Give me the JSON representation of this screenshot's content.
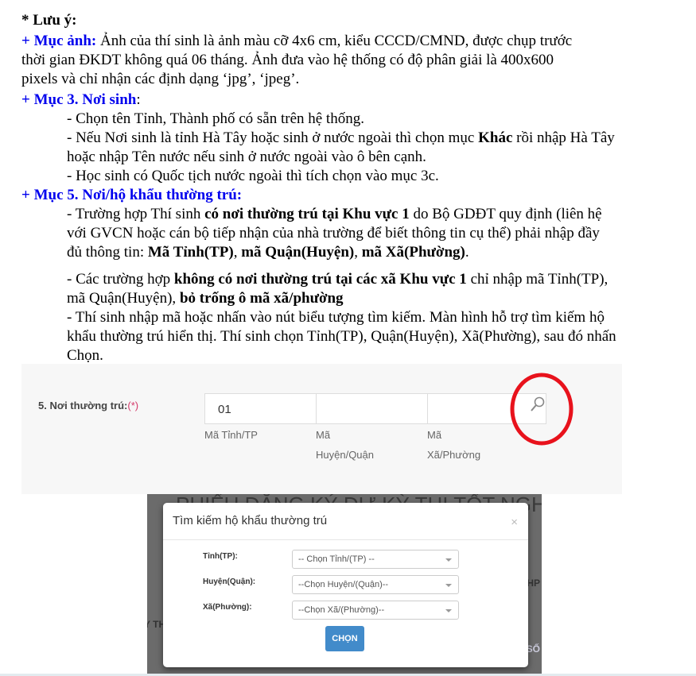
{
  "document": {
    "lines": [
      [
        {
          "t": "* Lưu ý:",
          "s": "b"
        }
      ],
      [
        {
          "t": "+ Mục ảnh:",
          "s": "bb"
        },
        {
          "t": " Ảnh của thí sinh là ảnh màu cỡ 4x6 cm, kiểu CCCD/CMND, được chụp trước",
          "s": "n"
        }
      ],
      [
        {
          "t": "thời gian ĐKDT không quá 06 tháng. Ảnh đưa vào hệ thống có độ phân giải là 400x600",
          "s": "n"
        }
      ],
      [
        {
          "t": "pixels và chỉ nhận các định dạng ‘jpg’, ‘jpeg’.",
          "s": "n"
        }
      ],
      [
        {
          "t": "+ Mục 3. Nơi sinh",
          "s": "bb"
        },
        {
          "t": ":",
          "s": "n"
        }
      ],
      [
        {
          "t": "- Chọn tên Tỉnh, Thành phố có sẵn trên hệ thống.",
          "s": "n"
        }
      ],
      [
        {
          "t": "- Nếu Nơi sinh là tỉnh Hà Tây hoặc sinh ở nước ngoài thì chọn mục ",
          "s": "n"
        },
        {
          "t": "Khác",
          "s": "b"
        },
        {
          "t": " rồi nhập Hà Tây",
          "s": "n"
        }
      ],
      [
        {
          "t": "hoặc nhập Tên nước nếu sinh ở nước ngoài vào ô bên cạnh.",
          "s": "n"
        }
      ],
      [
        {
          "t": "- Học sinh có Quốc tịch nước ngoài thì tích chọn vào mục 3c.",
          "s": "n"
        }
      ],
      [
        {
          "t": "+ Mục 5. Nơi/hộ khẩu thường trú:",
          "s": "bb"
        }
      ],
      [
        {
          "t": "- Trường hợp Thí sinh ",
          "s": "n"
        },
        {
          "t": "có nơi thường trú tại Khu vực 1",
          "s": "b"
        },
        {
          "t": " do Bộ GDĐT quy định (liên hệ",
          "s": "n"
        }
      ],
      [
        {
          "t": "với GVCN hoặc cán bộ tiếp nhận của nhà trường để biết thông tin cụ thể) phải nhập đầy",
          "s": "n"
        }
      ],
      [
        {
          "t": "đủ thông tin: ",
          "s": "n"
        },
        {
          "t": "Mã Tỉnh(TP)",
          "s": "b"
        },
        {
          "t": ", ",
          "s": "n"
        },
        {
          "t": "mã Quận(Huyện)",
          "s": "b"
        },
        {
          "t": ", ",
          "s": "n"
        },
        {
          "t": "mã Xã(Phường)",
          "s": "b"
        },
        {
          "t": ".",
          "s": "n"
        }
      ],
      [
        {
          "t": "- Các trường hợp ",
          "s": "n"
        },
        {
          "t": "không có nơi thường trú tại các xã Khu vực 1",
          "s": "b"
        },
        {
          "t": " chỉ nhập mã Tỉnh(TP),",
          "s": "n"
        }
      ],
      [
        {
          "t": "mã Quận(Huyện), ",
          "s": "n"
        },
        {
          "t": "bỏ trống ô mã xã/phường",
          "s": "b"
        }
      ],
      [
        {
          "t": "- Thí sinh nhập mã hoặc nhấn vào nút biểu tượng tìm kiếm. Màn hình hỗ trợ tìm kiếm hộ",
          "s": "n"
        }
      ],
      [
        {
          "t": "khẩu thường trú hiển thị. Thí sinh chọn Tỉnh(TP), Quận(Huyện), Xã(Phường), sau đó nhấn",
          "s": "n"
        }
      ],
      [
        {
          "t": "Chọn.",
          "s": "n"
        }
      ]
    ]
  },
  "form_screenshot": {
    "label": "5. Nơi thường trú:",
    "required_mark": "(*)",
    "province_code": "01",
    "district_code": "",
    "ward_code": "",
    "province_caption": "Mã Tỉnh/TP",
    "district_caption_1": "Mã",
    "district_caption_2": "Huyện/Quận",
    "ward_caption_1": "Mã",
    "ward_caption_2": "Xã/Phường",
    "search_icon": "magnifier-icon",
    "highlight_color": "#e8121c"
  },
  "modal_screenshot": {
    "background_title": "PHIẾU ĐĂNG KÝ DỰ KỲ THI TỐT NGHIỆP THPT",
    "background_fragment_right": "THP",
    "background_fragment_left": "Y TH",
    "background_fragment_right2": "SỐ",
    "title": "Tìm kiếm hộ khẩu thường trú",
    "close": "×",
    "fields": [
      {
        "label": "Tỉnh(TP):",
        "value": "-- Chọn Tỉnh/(TP) --"
      },
      {
        "label": "Huyện(Quận):",
        "value": "--Chọn Huyện/(Quận)--"
      },
      {
        "label": "Xã(Phường):",
        "value": "--Chọn Xã/(Phường)--"
      }
    ],
    "button": "CHỌN",
    "button_color": "#428bca"
  }
}
